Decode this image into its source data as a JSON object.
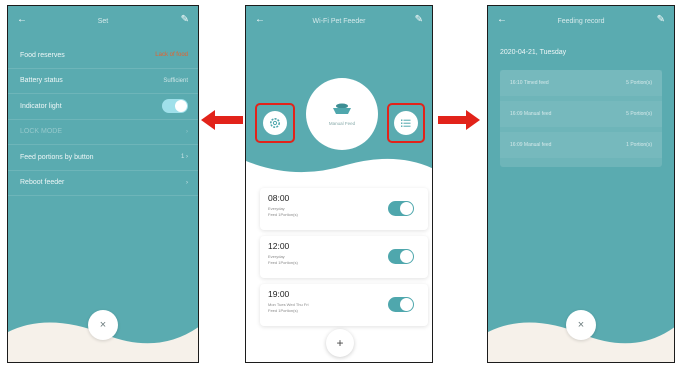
{
  "settings_screen": {
    "title": "Set",
    "rows": [
      {
        "label": "Food reserves",
        "value": "Lack of food"
      },
      {
        "label": "Battery status",
        "value": "Sufficient"
      },
      {
        "label": "Indicator light",
        "value": ""
      },
      {
        "label": "LOCK MODE",
        "value": ""
      },
      {
        "label": "Feed portions by button",
        "value": "1"
      },
      {
        "label": "Reboot feeder",
        "value": ""
      }
    ],
    "indicator_light_on": true
  },
  "main_screen": {
    "title": "Wi-Fi Pet Feeder",
    "feeder_label": "Manual Feed",
    "schedules": [
      {
        "time": "08:00",
        "repeat": "Everyday",
        "portion": "Feed 1Portion(s)",
        "enabled": true
      },
      {
        "time": "12:00",
        "repeat": "Everyday",
        "portion": "Feed 1Portion(s)",
        "enabled": true
      },
      {
        "time": "19:00",
        "repeat": "Mon  Tues  Wed  Thu  Fri",
        "portion": "Feed 1Portion(s)",
        "enabled": true
      }
    ],
    "add_label": "+"
  },
  "record_screen": {
    "title": "Feeding record",
    "date": "2020-04-21, Tuesday",
    "records": [
      {
        "time": "16:10",
        "type": "Timed feed",
        "portions": "5 Portion(s)"
      },
      {
        "time": "16:09",
        "type": "Manual feed",
        "portions": "5 Portion(s)"
      },
      {
        "time": "16:09",
        "type": "Manual feed",
        "portions": "1 Portion(s)"
      }
    ]
  },
  "icons": {
    "back": "←",
    "edit": "✎",
    "chevron": "›",
    "close": "×"
  },
  "colors": {
    "teal": "#5aabb0",
    "alert": "#e8612c",
    "highlight": "#e2231a"
  }
}
